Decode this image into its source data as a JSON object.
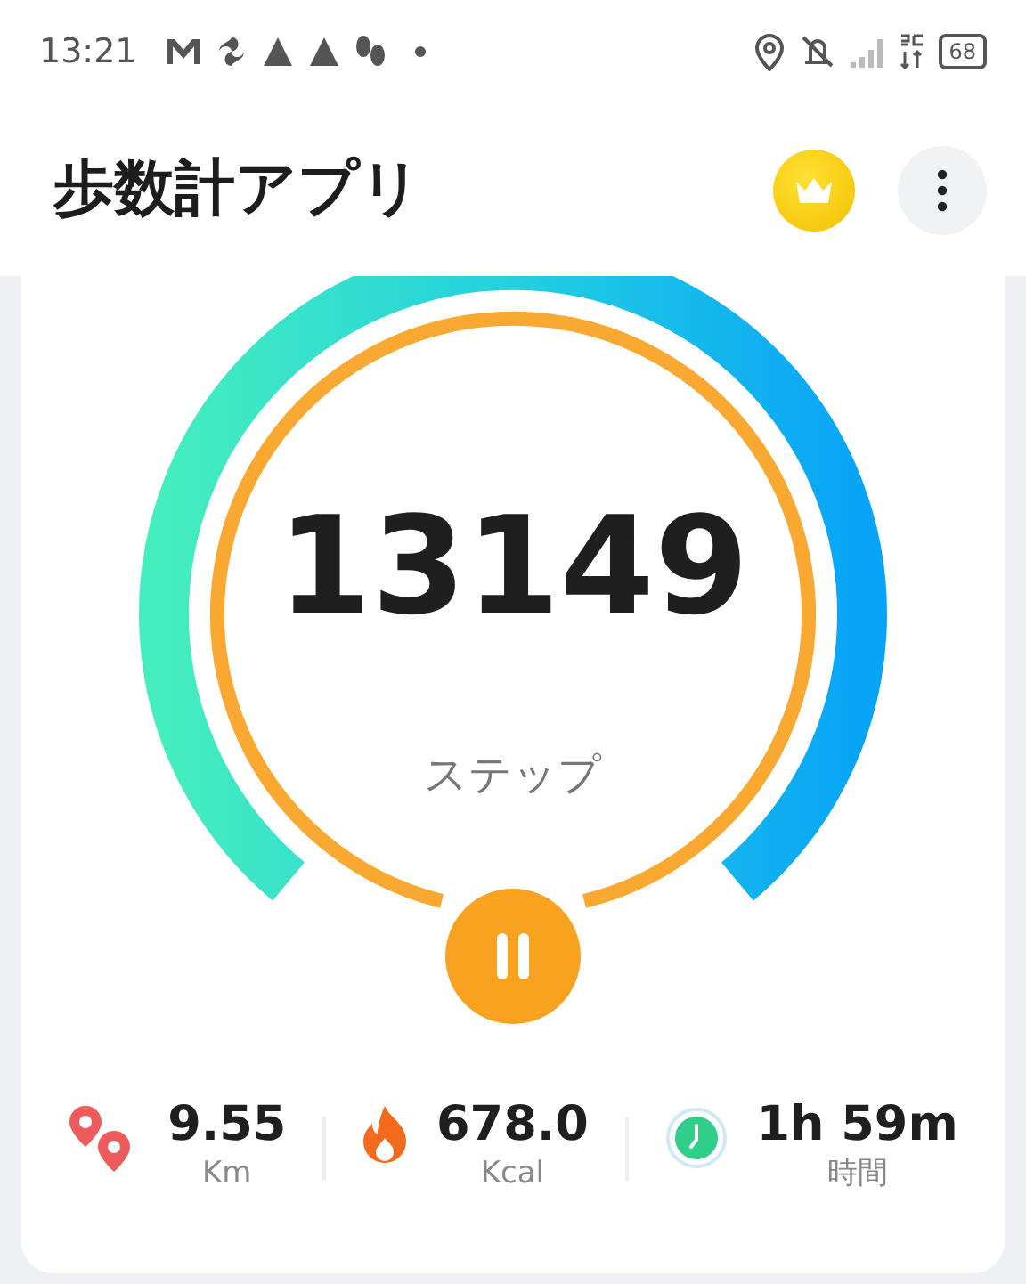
{
  "status_bar": {
    "time": "13:21",
    "battery": "68"
  },
  "header": {
    "title": "歩数計アプリ"
  },
  "counter": {
    "steps": "13149",
    "unit": "ステップ"
  },
  "stats": [
    {
      "kind": "distance",
      "value": "9.55",
      "unit": "Km"
    },
    {
      "kind": "calories",
      "value": "678.0",
      "unit": "Kcal"
    },
    {
      "kind": "duration",
      "value": "1h 59m",
      "unit": "時間"
    }
  ]
}
